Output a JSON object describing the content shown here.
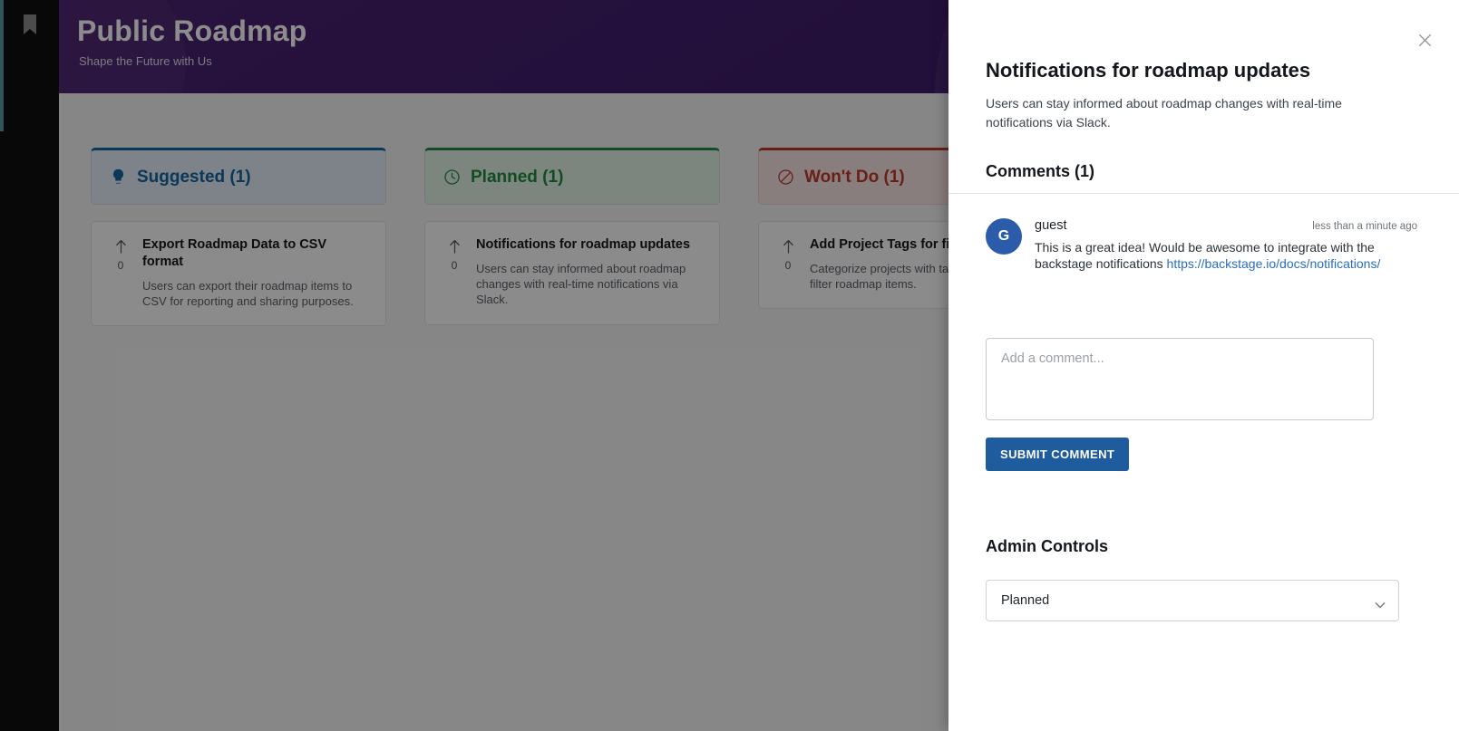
{
  "sidebar": {
    "logo_icon": "bookmark-icon",
    "accent_color": "#5a9aa0"
  },
  "header": {
    "title": "Public Roadmap",
    "subtitle": "Shape the Future with Us",
    "background_color": "#4b2273"
  },
  "board": {
    "columns": [
      {
        "label": "Suggested (1)",
        "icon": "lightbulb-icon",
        "accent_color": "#1565a0",
        "cards": [
          {
            "title": "Export Roadmap Data to CSV format",
            "description": "Users can export their roadmap items to CSV for reporting and sharing purposes.",
            "votes": "0",
            "vote_icon": "upvote-arrow-icon"
          }
        ]
      },
      {
        "label": "Planned (1)",
        "icon": "clock-icon",
        "accent_color": "#1f8a41",
        "cards": [
          {
            "title": "Notifications for roadmap updates",
            "description": "Users can stay informed about roadmap changes with real-time notifications via Slack.",
            "votes": "0",
            "vote_icon": "upvote-arrow-icon"
          }
        ]
      },
      {
        "label": "Won't Do (1)",
        "icon": "block-circle-slash-icon",
        "accent_color": "#c0392b",
        "cards": [
          {
            "title": "Add Project Tags for filtering",
            "description": "Categorize projects with tags to quickly filter roadmap items.",
            "votes": "0",
            "vote_icon": "upvote-arrow-icon"
          }
        ]
      }
    ]
  },
  "drawer": {
    "close_icon": "close-x-icon",
    "title": "Notifications for roadmap updates",
    "description": "Users can stay informed about roadmap changes with real-time notifications via Slack.",
    "comments_heading": "Comments (1)",
    "comments": [
      {
        "avatar_initial": "G",
        "avatar_color": "#2a5caa",
        "author": "guest",
        "time": "less than a minute ago",
        "text": "This is a great idea! Would be awesome to integrate with the backstage notifications ",
        "link_text": "https://backstage.io/docs/notifications/"
      }
    ],
    "comment_input": {
      "placeholder": "Add a comment...",
      "value": ""
    },
    "submit_label": "SUBMIT COMMENT",
    "admin_heading": "Admin Controls",
    "status_select": {
      "value": "Planned",
      "arrow_icon": "chevron-down-icon"
    }
  }
}
